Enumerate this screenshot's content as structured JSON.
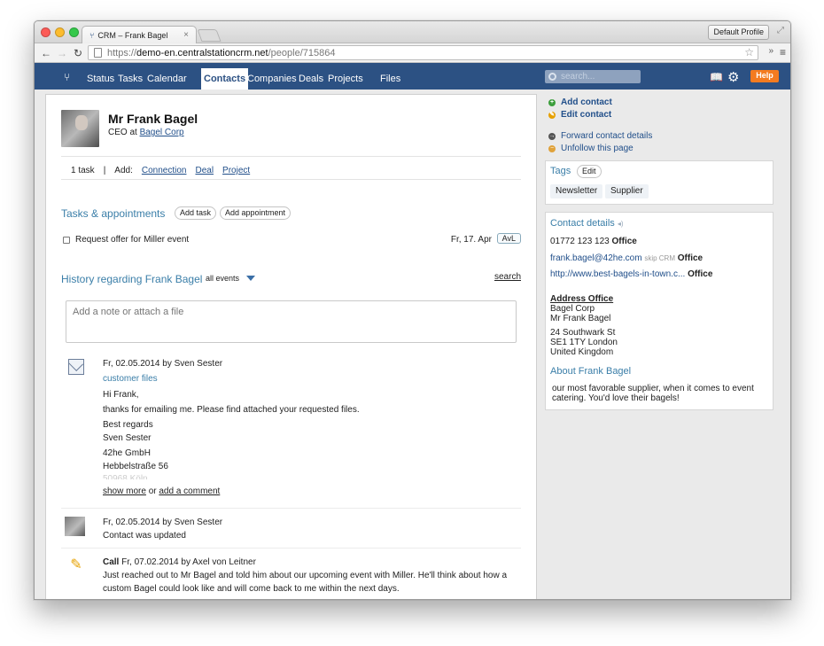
{
  "browser": {
    "tab_title": "CRM – Frank Bagel",
    "tab_close": "×",
    "profile": "Default Profile",
    "url_scheme": "https://",
    "url_host": "demo-en.centralstationcrm.net",
    "url_path": "/people/715864",
    "ext": "»"
  },
  "nav": {
    "items": [
      "Status",
      "Tasks",
      "Calendar",
      "Contacts",
      "Companies",
      "Deals",
      "Projects",
      "Files"
    ],
    "search_placeholder": "search...",
    "help": "Help"
  },
  "person": {
    "name": "Mr Frank Bagel",
    "role_prefix": "CEO at",
    "company": "Bagel Corp"
  },
  "taskline": {
    "count": "1 task",
    "sep": "|",
    "add_label": "Add:",
    "links": [
      "Connection",
      "Deal",
      "Project"
    ]
  },
  "tasks": {
    "title": "Tasks & appointments",
    "add_task": "Add task",
    "add_appointment": "Add appointment",
    "item_label": "Request offer for Miller event",
    "item_date": "Fr, 17. Apr",
    "item_badge": "AvL"
  },
  "history": {
    "title": "History regarding Frank Bagel",
    "filter": "all events",
    "search": "search",
    "note_placeholder": "Add a note or attach a file",
    "events": [
      {
        "header": "Fr, 02.05.2014 by Sven Sester",
        "link": "customer files",
        "lines": [
          "Hi Frank,",
          "thanks for emailing me. Please find attached your requested files.",
          "Best regards",
          "Sven Sester",
          "42he GmbH",
          "Hebbelstraße 56",
          "50968 Köln"
        ],
        "show_more": "show more",
        "or": "or",
        "add_comment": "add a comment"
      },
      {
        "header": "Fr, 02.05.2014 by Sven Sester",
        "text": "Contact was updated"
      },
      {
        "type": "Call",
        "header": "Fr, 07.02.2014 by Axel von Leitner",
        "text1": "Just reached out to Mr Bagel and told him about our upcoming event with Miller. He'll think about how a",
        "text2": "custom Bagel could look like and will come back to me within the next days."
      }
    ]
  },
  "side": {
    "actions": [
      "Add contact",
      "Edit contact",
      "Forward contact details",
      "Unfollow this page"
    ],
    "tags_title": "Tags",
    "tags_edit": "Edit",
    "tags": [
      "Newsletter",
      "Supplier"
    ],
    "details_title": "Contact details",
    "phone": "01772 123 123",
    "phone_type": "Office",
    "email": "frank.bagel@42he.com",
    "email_skip": "skip CRM",
    "email_type": "Office",
    "website": "http://www.best-bagels-in-town.c...",
    "website_type": "Office",
    "address_title": "Address Office",
    "address_lines": [
      "Bagel Corp",
      "Mr Frank Bagel"
    ],
    "street_lines": [
      "24 Southwark St",
      "SE1 1TY London",
      "United Kingdom"
    ],
    "about_title": "About Frank Bagel",
    "about_text1": "our most favorable supplier, when it comes to event",
    "about_text2": "catering. You'd love their bagels!"
  }
}
